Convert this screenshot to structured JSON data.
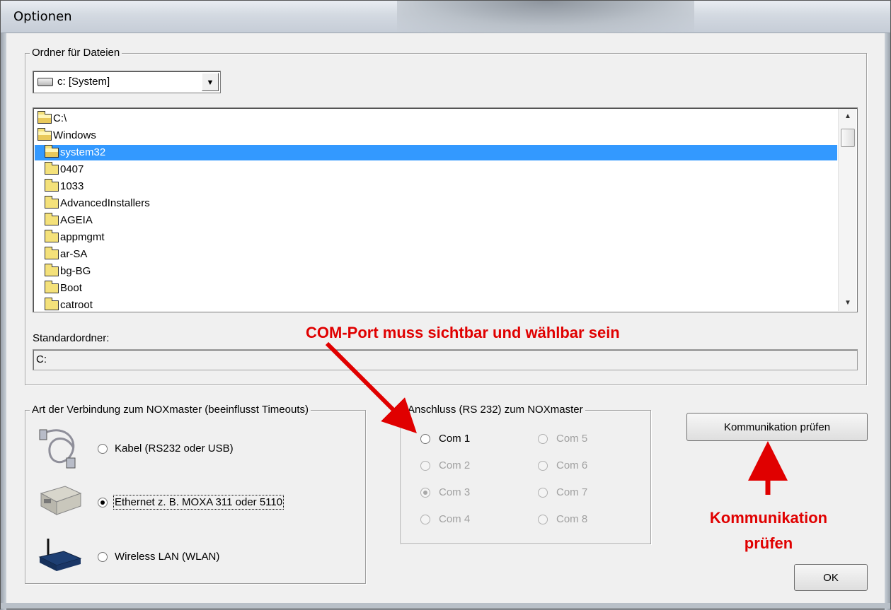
{
  "window": {
    "title": "Optionen"
  },
  "files_group": {
    "legend": "Ordner für Dateien",
    "drive": {
      "value": "c: [System]",
      "icon": "drive-icon"
    },
    "folders": [
      {
        "name": "C:\\",
        "state": "open"
      },
      {
        "name": "Windows",
        "state": "open"
      },
      {
        "name": "system32",
        "state": "open",
        "selected": true
      },
      {
        "name": "0407",
        "state": "closed"
      },
      {
        "name": "1033",
        "state": "closed"
      },
      {
        "name": "AdvancedInstallers",
        "state": "closed"
      },
      {
        "name": "AGEIA",
        "state": "closed"
      },
      {
        "name": "appmgmt",
        "state": "closed"
      },
      {
        "name": "ar-SA",
        "state": "closed"
      },
      {
        "name": "bg-BG",
        "state": "closed"
      },
      {
        "name": "Boot",
        "state": "closed"
      },
      {
        "name": "catroot",
        "state": "closed"
      }
    ],
    "standard_label": "Standardordner:",
    "standard_value": "C:"
  },
  "connection_group": {
    "legend": "Art der Verbindung zum NOXmaster (beeinflusst Timeouts)",
    "options": [
      {
        "label": "Kabel (RS232 oder USB)",
        "checked": false,
        "icon": "serial-cable-icon"
      },
      {
        "label": "Ethernet z. B. MOXA 311 oder 5110",
        "checked": true,
        "icon": "moxa-device-icon"
      },
      {
        "label": "Wireless LAN (WLAN)",
        "checked": false,
        "icon": "wlan-router-icon"
      }
    ]
  },
  "port_group": {
    "legend": "Anschluss (RS 232) zum NOXmaster",
    "ports": [
      {
        "label": "Com 1",
        "checked": false,
        "enabled": true
      },
      {
        "label": "Com 2",
        "checked": false,
        "enabled": false
      },
      {
        "label": "Com 3",
        "checked": true,
        "enabled": false
      },
      {
        "label": "Com 4",
        "checked": false,
        "enabled": false
      },
      {
        "label": "Com 5",
        "checked": false,
        "enabled": false
      },
      {
        "label": "Com 6",
        "checked": false,
        "enabled": false
      },
      {
        "label": "Com 7",
        "checked": false,
        "enabled": false
      },
      {
        "label": "Com 8",
        "checked": false,
        "enabled": false
      }
    ]
  },
  "buttons": {
    "check": "Kommunikation prüfen",
    "ok": "OK"
  },
  "annotations": {
    "com_note": "COM-Port muss sichtbar und wählbar sein",
    "check_note_line1": "Kommunikation",
    "check_note_line2": "prüfen",
    "color": "#e00000"
  },
  "colors": {
    "selection": "#3399ff",
    "dialog_bg": "#f0f0f0"
  }
}
